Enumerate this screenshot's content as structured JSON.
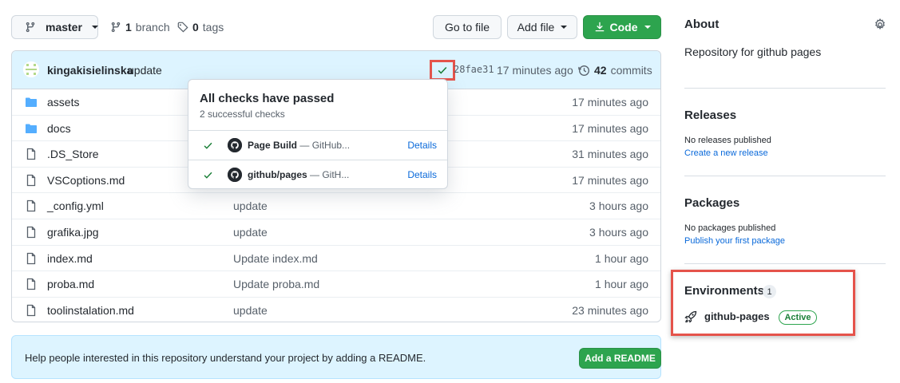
{
  "toolbar": {
    "branch_name": "master",
    "branch_count": "1",
    "branch_label": "branch",
    "tag_count": "0",
    "tag_label": "tags",
    "goto_label": "Go to file",
    "addfile_label": "Add file",
    "code_label": "Code"
  },
  "commit": {
    "author": "kingakisielinska",
    "message": "update",
    "sha": "28fae31",
    "time": "17 minutes ago",
    "commit_count": "42",
    "commit_label": "commits"
  },
  "files": [
    {
      "name": "assets",
      "type": "folder",
      "message": "",
      "time": "17 minutes ago"
    },
    {
      "name": "docs",
      "type": "folder",
      "message": "",
      "time": "17 minutes ago"
    },
    {
      "name": ".DS_Store",
      "type": "file",
      "message": "",
      "time": "31 minutes ago"
    },
    {
      "name": "VSCoptions.md",
      "type": "file",
      "message": "",
      "time": "17 minutes ago"
    },
    {
      "name": "_config.yml",
      "type": "file",
      "message": "update",
      "time": "3 hours ago"
    },
    {
      "name": "grafika.jpg",
      "type": "file",
      "message": "update",
      "time": "3 hours ago"
    },
    {
      "name": "index.md",
      "type": "file",
      "message": "Update index.md",
      "time": "1 hour ago"
    },
    {
      "name": "proba.md",
      "type": "file",
      "message": "Update proba.md",
      "time": "1 hour ago"
    },
    {
      "name": "toolinstalation.md",
      "type": "file",
      "message": "update",
      "time": "23 minutes ago"
    }
  ],
  "checks_popover": {
    "title": "All checks have passed",
    "subtitle": "2 successful checks",
    "checks": [
      {
        "name": "Page Build",
        "detail": "— GitHub...",
        "link": "Details"
      },
      {
        "name": "github/pages",
        "detail": "— GitH...",
        "link": "Details"
      }
    ]
  },
  "readme": {
    "text": "Help people interested in this repository understand your project by adding a README.",
    "button": "Add a README"
  },
  "sidebar": {
    "about_title": "About",
    "about_desc": "Repository for github pages",
    "releases_title": "Releases",
    "releases_empty": "No releases published",
    "releases_link": "Create a new release",
    "packages_title": "Packages",
    "packages_empty": "No packages published",
    "packages_link": "Publish your first package",
    "env_title": "Environments",
    "env_count": "1",
    "env_name": "github-pages",
    "env_status": "Active"
  },
  "colors": {
    "accent_green": "#2da44e",
    "link_blue": "#0969da",
    "highlight_red": "#e5534b",
    "info_blue_bg": "#ddf4ff"
  }
}
